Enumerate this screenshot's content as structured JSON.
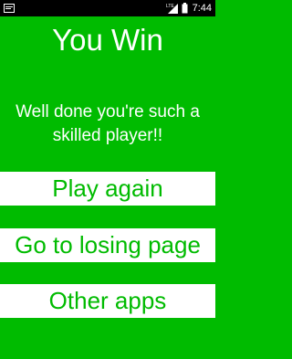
{
  "status_bar": {
    "time": "7:44",
    "network_label": "LTE"
  },
  "screen": {
    "title": "You Win",
    "message": "Well done you're such a skilled player!!"
  },
  "buttons": {
    "play_again": "Play again",
    "losing_page": "Go to losing page",
    "other_apps": "Other apps"
  },
  "colors": {
    "background": "#00bb00",
    "button_background": "#ffffff",
    "button_text": "#00bb00",
    "text": "#ffffff"
  }
}
